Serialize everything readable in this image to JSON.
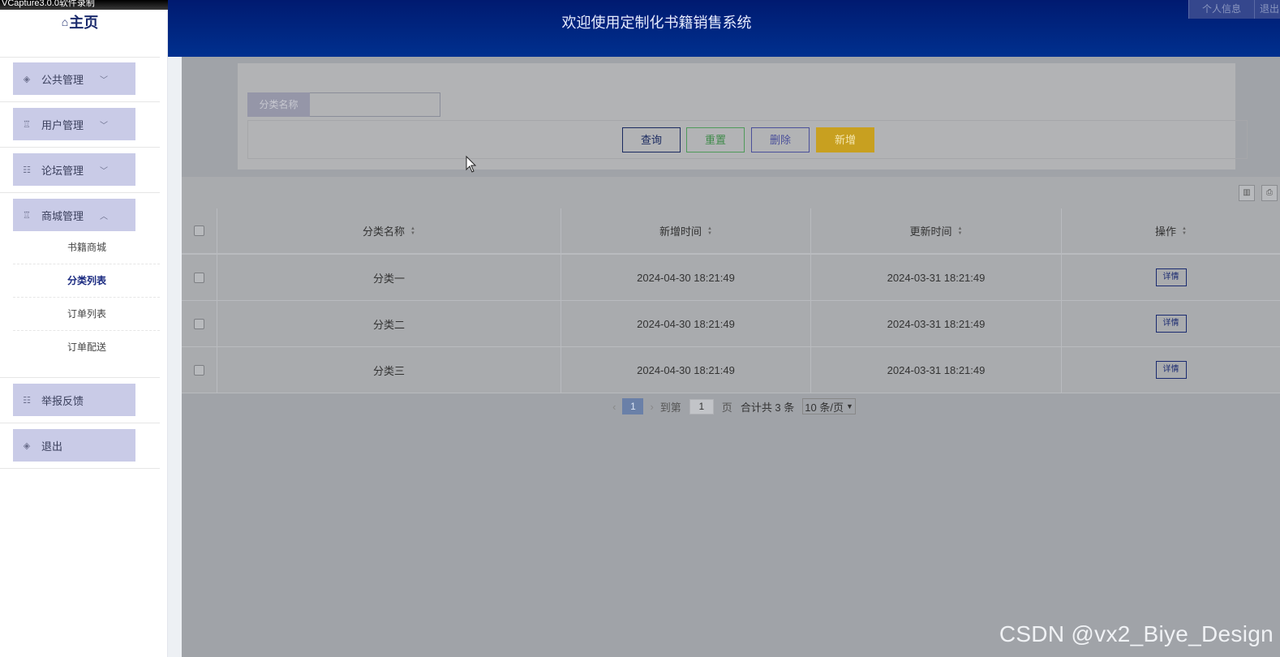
{
  "recording_banner": "VCapture3.0.0软件录制",
  "logo": {
    "icon": "home-icon",
    "text": "主页"
  },
  "header": {
    "title": "欢迎使用定制化书籍销售系统",
    "tabs": [
      "个人信息",
      "退出"
    ]
  },
  "sidebar": {
    "menus": [
      {
        "label": "公共管理",
        "icon": "layers-icon",
        "expanded": false
      },
      {
        "label": "用户管理",
        "icon": "alarm-icon",
        "expanded": false
      },
      {
        "label": "论坛管理",
        "icon": "list-icon",
        "expanded": false
      },
      {
        "label": "商城管理",
        "icon": "alarm-icon",
        "expanded": true,
        "children": [
          "书籍商城",
          "分类列表",
          "订单列表",
          "订单配送"
        ],
        "active_child": "分类列表"
      },
      {
        "label": "举报反馈",
        "icon": "list-icon",
        "expanded": false
      },
      {
        "label": "退出",
        "icon": "layers-icon",
        "expanded": false
      }
    ]
  },
  "search": {
    "label": "分类名称",
    "value": ""
  },
  "buttons": {
    "query": "查询",
    "reset": "重置",
    "delete": "删除",
    "add": "新增"
  },
  "table": {
    "headers": [
      "分类名称",
      "新增时间",
      "更新时间",
      "操作"
    ],
    "rows": [
      {
        "name": "分类一",
        "added": "2024-04-30 18:21:49",
        "updated": "2024-03-31 18:21:49",
        "action": "详情"
      },
      {
        "name": "分类二",
        "added": "2024-04-30 18:21:49",
        "updated": "2024-03-31 18:21:49",
        "action": "详情"
      },
      {
        "name": "分类三",
        "added": "2024-04-30 18:21:49",
        "updated": "2024-03-31 18:21:49",
        "action": "详情"
      }
    ]
  },
  "pager": {
    "current_page": "1",
    "goto_label": "到第",
    "goto_value": "1",
    "page_unit": "页",
    "total_text": "合计共 3 条",
    "page_size": "10 条/页"
  },
  "watermark": "CSDN @vx2_Biye_Design"
}
